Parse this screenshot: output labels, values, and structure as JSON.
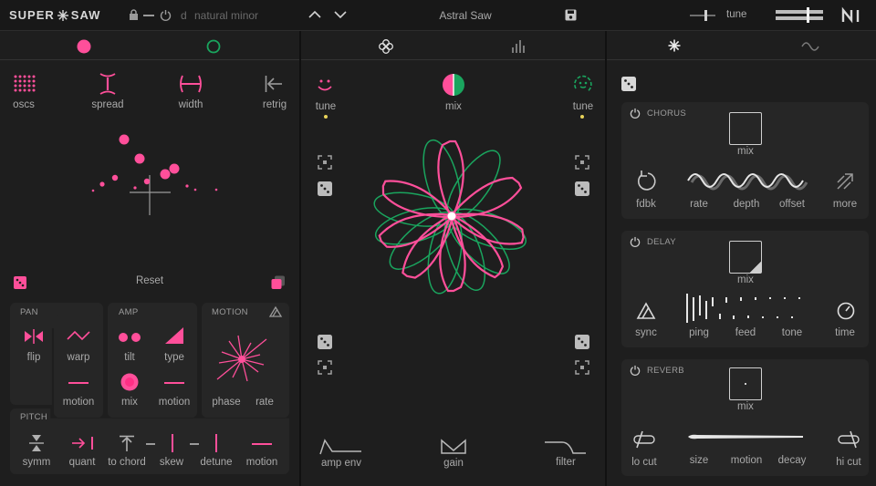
{
  "colors": {
    "pink": "#ff4f9a",
    "green": "#1aa55e",
    "bg": "#1e1e1e",
    "panel": "#262626",
    "text": "#a9a9a9",
    "yellow": "#e8d35a"
  },
  "top": {
    "logo_left": "SUPER",
    "logo_right": "SAW",
    "key": "d",
    "scale": "natural minor",
    "preset": "Astral Saw",
    "tune_label": "tune"
  },
  "left": {
    "tabs": [
      {
        "icon": "circle-filled-pink"
      },
      {
        "icon": "circle-outline-green"
      }
    ],
    "controls": {
      "oscs": "oscs",
      "spread": "spread",
      "width": "width",
      "retrig": "retrig"
    },
    "reset": "Reset",
    "pan": {
      "title": "PAN",
      "flip": "flip",
      "warp": "warp",
      "motion": "motion"
    },
    "amp": {
      "title": "AMP",
      "tilt": "tilt",
      "type": "type",
      "mix": "mix",
      "motion": "motion"
    },
    "motion": {
      "title": "MOTION",
      "phase": "phase",
      "rate": "rate"
    },
    "pitch": {
      "title": "PITCH",
      "symm": "symm",
      "quant": "quant",
      "to_chord": "to chord",
      "skew": "skew",
      "detune": "detune",
      "motion": "motion"
    }
  },
  "center": {
    "tabs": [
      {
        "icon": "flower-icon"
      },
      {
        "icon": "bars-icon"
      }
    ],
    "tune_left": "tune",
    "mix": "mix",
    "tune_right": "tune",
    "amp_env": "amp env",
    "gain": "gain",
    "filter": "filter"
  },
  "right": {
    "tabs": [
      {
        "icon": "asterisk-icon"
      },
      {
        "icon": "wave-icon"
      }
    ],
    "chorus": {
      "title": "CHORUS",
      "mix": "mix",
      "fdbk": "fdbk",
      "rate": "rate",
      "depth": "depth",
      "offset": "offset",
      "more": "more"
    },
    "delay": {
      "title": "DELAY",
      "mix": "mix",
      "sync": "sync",
      "ping": "ping",
      "feed": "feed",
      "tone": "tone",
      "time": "time"
    },
    "reverb": {
      "title": "REVERB",
      "mix": "mix",
      "lo_cut": "lo cut",
      "size": "size",
      "motion": "motion",
      "decay": "decay",
      "hi_cut": "hi cut"
    }
  }
}
